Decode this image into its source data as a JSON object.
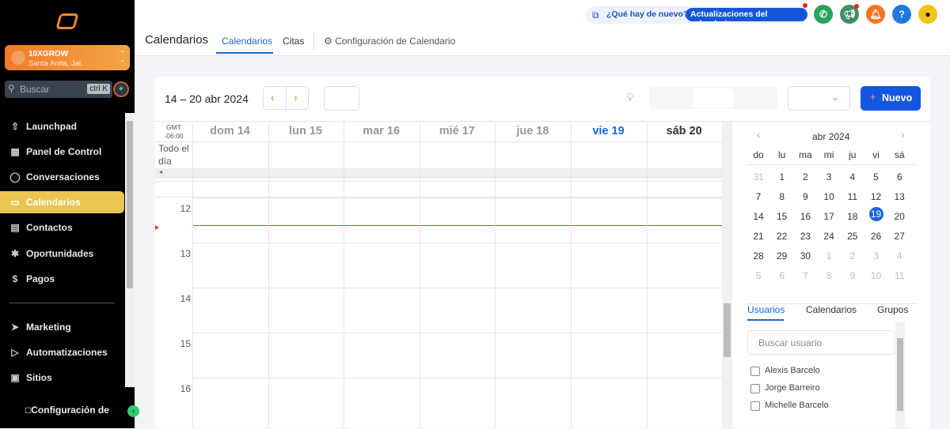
{
  "sidebar": {
    "account": {
      "name": "10XGROW",
      "location": "Santa Anita, Jal."
    },
    "search": {
      "placeholder": "Buscar",
      "shortcut": "ctrl K"
    },
    "items": [
      {
        "label": "Launchpad",
        "icon": "launchpad-icon"
      },
      {
        "label": "Panel de Control",
        "icon": "dashboard-icon"
      },
      {
        "label": "Conversaciones",
        "icon": "chat-icon"
      },
      {
        "label": "Calendarios",
        "icon": "calendar-icon",
        "active": true
      },
      {
        "label": "Contactos",
        "icon": "contacts-icon"
      },
      {
        "label": "Oportunidades",
        "icon": "opportunities-icon"
      },
      {
        "label": "Pagos",
        "icon": "payments-icon"
      },
      {
        "label": "Marketing",
        "icon": "send-icon"
      },
      {
        "label": "Automatizaciones",
        "icon": "automation-icon"
      },
      {
        "label": "Sitios",
        "icon": "sites-icon"
      }
    ],
    "settings_label": "□Configuración de"
  },
  "header": {
    "whats_new": "¿Qué hay de nuevo?",
    "update_badge": "Actualizaciones del calendario",
    "page_title": "Calendarios",
    "tabs": [
      "Calendarios",
      "Citas",
      "Configuración de Calendario"
    ]
  },
  "toolbar": {
    "date_range": "14 – 20 abr 2024",
    "new_label": "Nuevo"
  },
  "calendar": {
    "timezone": [
      "GMT",
      "-06:00"
    ],
    "all_day": [
      "Todo el",
      "día"
    ],
    "days": [
      "dom 14",
      "lun 15",
      "mar 16",
      "mié 17",
      "jue 18",
      "vie 19",
      "sáb 20"
    ],
    "today_index": 5,
    "hours": [
      "12",
      "13",
      "14",
      "15",
      "16"
    ]
  },
  "mini_calendar": {
    "month": "abr 2024",
    "weekdays": [
      "do",
      "lu",
      "ma",
      "mi",
      "ju",
      "vi",
      "sá"
    ],
    "weeks": [
      [
        "31",
        "1",
        "2",
        "3",
        "4",
        "5",
        "6"
      ],
      [
        "7",
        "8",
        "9",
        "10",
        "11",
        "12",
        "13"
      ],
      [
        "14",
        "15",
        "16",
        "17",
        "18",
        "19",
        "20"
      ],
      [
        "21",
        "22",
        "23",
        "24",
        "25",
        "26",
        "27"
      ],
      [
        "28",
        "29",
        "30",
        "1",
        "2",
        "3",
        "4"
      ],
      [
        "5",
        "6",
        "7",
        "8",
        "9",
        "10",
        "11"
      ]
    ],
    "selected": "19"
  },
  "panel": {
    "tabs": [
      "Usuarios",
      "Calendarios",
      "Grupos"
    ],
    "search_placeholder": "Buscar usuario",
    "users": [
      "Alexis Barcelo",
      "Jorge Barreiro",
      "Michelle Barcelo"
    ]
  },
  "colors": {
    "accent": "#1b66d8",
    "active_nav": "#eac552",
    "now_line": "#e53935"
  }
}
